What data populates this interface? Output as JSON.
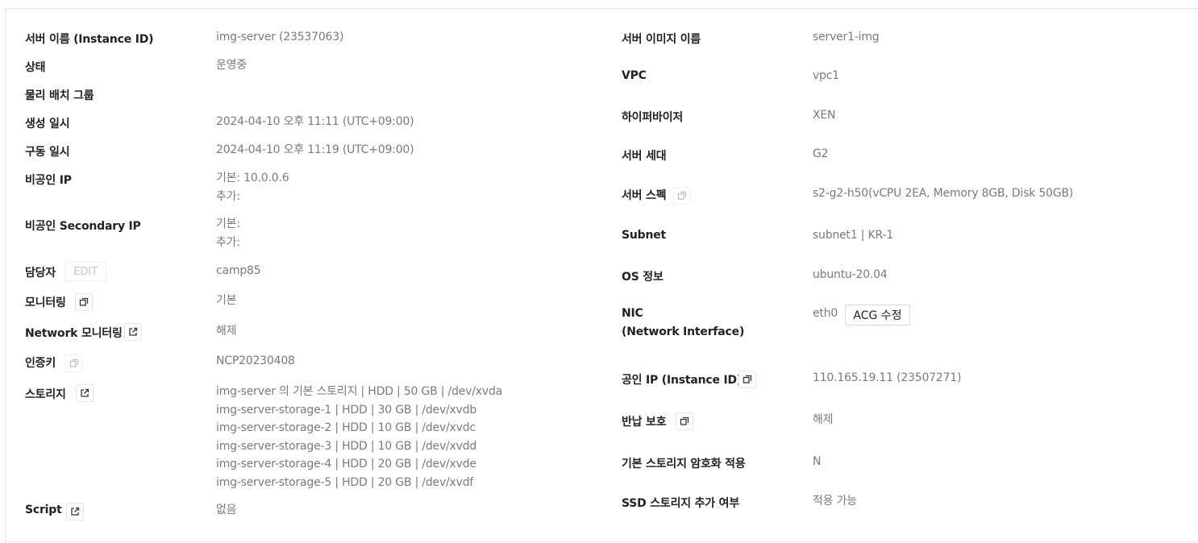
{
  "left": {
    "server_name": {
      "label": "서버 이름 (Instance ID)",
      "value": "img-server (23537063)"
    },
    "status": {
      "label": "상태",
      "value": "운영중"
    },
    "placement_group": {
      "label": "물리 배치 그룹",
      "value": ""
    },
    "created_at": {
      "label": "생성 일시",
      "value": "2024-04-10 오후 11:11 (UTC+09:00)"
    },
    "started_at": {
      "label": "구동 일시",
      "value": "2024-04-10 오후 11:19 (UTC+09:00)"
    },
    "private_ip": {
      "label": "비공인 IP",
      "lines": [
        "기본: 10.0.0.6",
        "추가:"
      ]
    },
    "secondary_ip": {
      "label": "비공인 Secondary IP",
      "lines": [
        "기본:",
        "추가:"
      ]
    },
    "owner": {
      "label": "담당자",
      "edit_label": "EDIT",
      "value": "camp85"
    },
    "monitoring": {
      "label": "모니터링",
      "value": "기본"
    },
    "network_monitoring": {
      "label": "Network 모니터링",
      "value": "해제"
    },
    "auth_key": {
      "label": "인증키",
      "value": "NCP20230408"
    },
    "storage": {
      "label": "스토리지",
      "lines": [
        "img-server 의 기본 스토리지 | HDD | 50 GB | /dev/xvda",
        "img-server-storage-1 | HDD | 30 GB | /dev/xvdb",
        "img-server-storage-2 | HDD | 10 GB | /dev/xvdc",
        "img-server-storage-3 | HDD | 10 GB | /dev/xvdd",
        "img-server-storage-4 | HDD | 20 GB | /dev/xvde",
        "img-server-storage-5 | HDD | 20 GB | /dev/xvdf"
      ]
    },
    "script": {
      "label": "Script",
      "value": "없음"
    }
  },
  "right": {
    "image_name": {
      "label": "서버 이미지 이름",
      "value": "server1-img"
    },
    "vpc": {
      "label": "VPC",
      "value": "vpc1"
    },
    "hypervisor": {
      "label": "하이퍼바이저",
      "value": "XEN"
    },
    "generation": {
      "label": "서버 세대",
      "value": "G2"
    },
    "spec": {
      "label": "서버 스펙",
      "value": "s2-g2-h50(vCPU 2EA, Memory 8GB, Disk 50GB)"
    },
    "subnet": {
      "label": "Subnet",
      "value": "subnet1 | KR-1"
    },
    "os": {
      "label": "OS 정보",
      "value": "ubuntu-20.04"
    },
    "nic": {
      "label_line1": "NIC",
      "label_line2": "(Network Interface)",
      "value": "eth0",
      "acg_button": "ACG 수정"
    },
    "public_ip": {
      "label": "공인 IP (Instance ID)",
      "value": "110.165.19.11 (23507271)"
    },
    "return_protection": {
      "label": "반납 보호",
      "value": "해제"
    },
    "encryption": {
      "label": "기본 스토리지 암호화 적용",
      "value": "N"
    },
    "ssd": {
      "label": "SSD 스토리지 추가 여부",
      "value": "적용 가능"
    }
  },
  "icons": {
    "copy": "copy-icon",
    "external": "external-link-icon"
  },
  "colors": {
    "label": "#222222",
    "value": "#7a7a7a",
    "border": "#e3e3e3",
    "edit_disabled": "#c4c4c4"
  }
}
